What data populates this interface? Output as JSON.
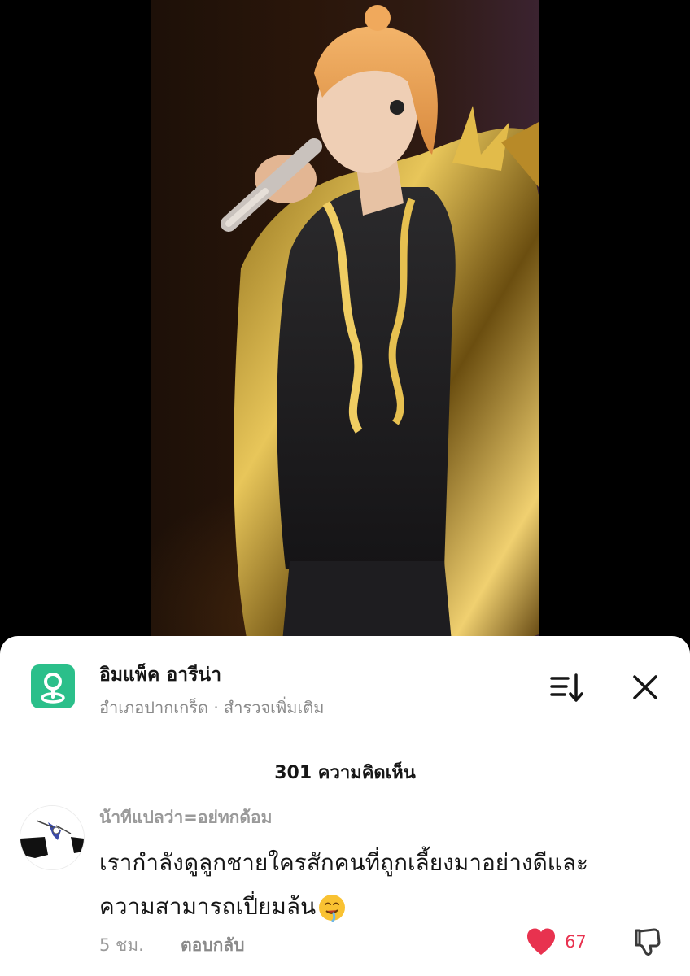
{
  "place": {
    "name": "อิมแพ็ค อารีน่า",
    "subtitle": "อำเภอปากเกร็ด · สำรวจเพิ่มเติม",
    "icon": "location-pin-icon",
    "icon_color": "#2bbf8a"
  },
  "header_actions": {
    "sort_icon": "sort-icon",
    "close_icon": "close-icon"
  },
  "comments": {
    "count_label": "301 ความคิดเห็น",
    "items": [
      {
        "username": "น้าทีแปลว่า=อยู่ทุกด้อม",
        "text_line1": "เรากำลังดูลูกชายใครสักคนที่ถูกเลี้ยงมาอย่างดีและ",
        "text_line2": "ความสามารถเปี่ยมล้น",
        "emoji": "drooling-face-emoji",
        "time": "5 ชม.",
        "reply_label": "ตอบกลับ",
        "like_count": "67",
        "like_color": "#e8324f"
      }
    ]
  }
}
